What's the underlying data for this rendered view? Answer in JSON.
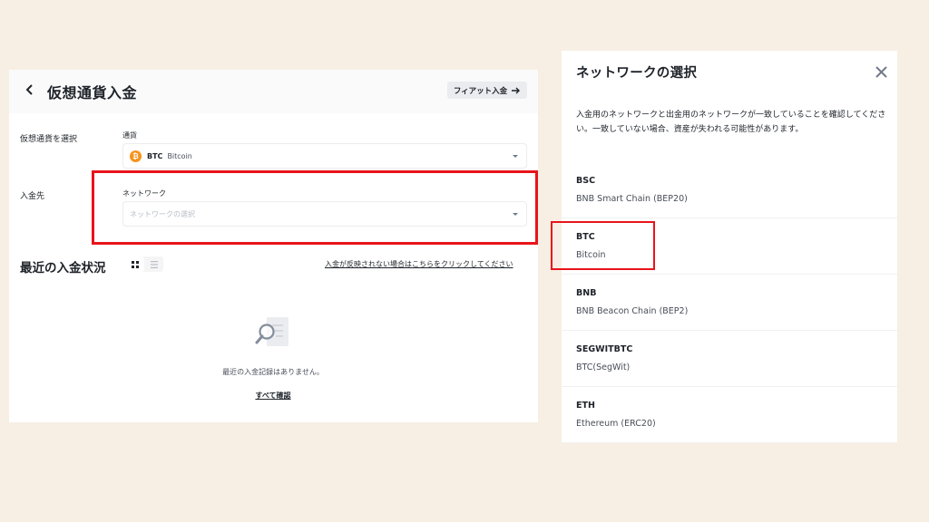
{
  "deposit": {
    "title": "仮想通貨入金",
    "fiat_button": "フィアット入金",
    "step1_label": "仮想通貨を選択",
    "currency_label": "通貨",
    "selected_coin": {
      "ticker": "BTC",
      "name": "Bitcoin",
      "icon_glyph": "₿"
    },
    "step2_label": "入金先",
    "network_label": "ネットワーク",
    "network_placeholder": "ネットワークの選択",
    "recent_title": "最近の入金状況",
    "issue_link": "入金が反映されない場合はこちらをクリックしてください",
    "empty_message": "最近の入金記録はありません。",
    "view_all": "すべて確認"
  },
  "network_modal": {
    "title": "ネットワークの選択",
    "notice": "入金用のネットワークと出金用のネットワークが一致していることを確認してください。一致していない場合、資産が失われる可能性があります。",
    "networks": [
      {
        "code": "BSC",
        "name": "BNB Smart Chain (BEP20)"
      },
      {
        "code": "BTC",
        "name": "Bitcoin"
      },
      {
        "code": "BNB",
        "name": "BNB Beacon Chain (BEP2)"
      },
      {
        "code": "SEGWITBTC",
        "name": "BTC(SegWit)"
      },
      {
        "code": "ETH",
        "name": "Ethereum (ERC20)"
      }
    ]
  },
  "colors": {
    "background": "#f7efe4",
    "highlight_red": "#e8141b",
    "bitcoin_orange": "#f7931a"
  }
}
